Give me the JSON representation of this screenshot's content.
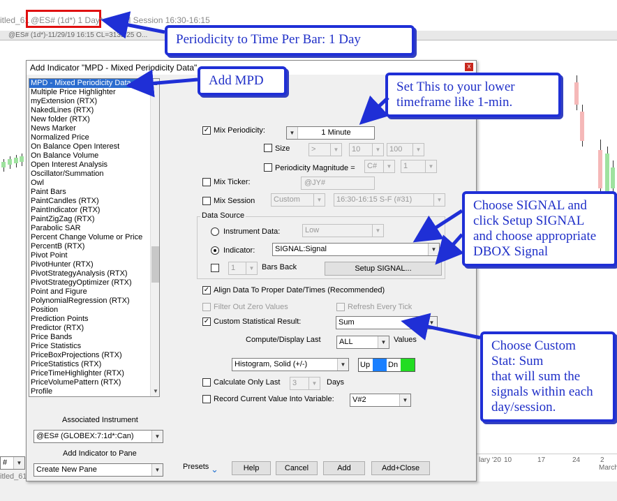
{
  "background": {
    "window_title": "itled_61",
    "symbol": "@ES# (1d*) 1 Day*",
    "session": "Full Session 16:30-16:15",
    "status_line": "@ES# (1d*)-11/29/19 16:15 CL=3135.25 O...",
    "x_ticks": [
      "lary '20",
      "10",
      "17",
      "24",
      "2",
      "March"
    ],
    "bottom_title": "itled_61"
  },
  "dialog": {
    "title": "Add Indicator \"MPD - Mixed Periodicity Data\"",
    "close": "x",
    "indicators": [
      "MPD - Mixed Periodicity Data",
      "Multiple Price Highlighter",
      "myExtension (RTX)",
      "NakedLines (RTX)",
      "New folder (RTX)",
      "News Marker",
      "Normalized Price",
      "On Balance Open Interest",
      "On Balance Volume",
      "Open Interest Analysis",
      "Oscillator/Summation",
      "Owl",
      "Paint Bars",
      "PaintCandles (RTX)",
      "PaintIndicator (RTX)",
      "PaintZigZag (RTX)",
      "Parabolic SAR",
      "Percent Change Volume or Price",
      "PercentB (RTX)",
      "Pivot Point",
      "PivotHunter (RTX)",
      "PivotStrategyAnalysis (RTX)",
      "PivotStrategyOptimizer (RTX)",
      "Point and Figure",
      "PolynomialRegression (RTX)",
      "Position",
      "Prediction Points",
      "Predictor (RTX)",
      "Price Bands",
      "Price Statistics",
      "PriceBoxProjections (RTX)",
      "PriceStatistics (RTX)",
      "PriceTimeHighlighter (RTX)",
      "PriceVolumePattern (RTX)",
      "Profile"
    ],
    "associated_instrument_label": "Associated Instrument",
    "associated_instrument": "@ES# (GLOBEX:7:1d*:Can)",
    "add_to_pane_label": "Add Indicator to Pane",
    "add_to_pane": "Create New Pane",
    "mix_periodicity": {
      "label": "Mix Periodicity:",
      "value": "1 Minute"
    },
    "size": {
      "label": "Size",
      "op": ">",
      "a": "10",
      "b": "100"
    },
    "periodicity_magnitude": {
      "label": "Periodicity Magnitude =",
      "a": "C#",
      "b": "1"
    },
    "mix_ticker": {
      "label": "Mix Ticker:",
      "value": "@JY#"
    },
    "mix_session": {
      "label": "Mix Session",
      "type": "Custom",
      "value": "16:30-16:15 S-F (#31)"
    },
    "data_source": {
      "label": "Data Source",
      "instrument_label": "Instrument Data:",
      "instrument_value": "Low",
      "indicator_label": "Indicator:",
      "indicator_value": "SIGNAL:Signal",
      "bars_back_value": "1",
      "bars_back_label": "Bars Back",
      "setup_button": "Setup SIGNAL..."
    },
    "align_data": "Align Data To Proper Date/Times (Recommended)",
    "filter_zero": "Filter Out Zero Values",
    "refresh_tick": "Refresh Every Tick",
    "custom_stat": {
      "label": "Custom Statistical Result:",
      "value": "Sum"
    },
    "compute_display": {
      "label": "Compute/Display Last",
      "value": "ALL",
      "unit": "Values"
    },
    "style": {
      "value": "Histogram, Solid (+/-)",
      "up": "Up",
      "dn": "Dn",
      "up_color": "#1a7fff",
      "dn_color": "#22dd22"
    },
    "calc_only_last": {
      "label": "Calculate Only Last",
      "value": "3",
      "unit": "Days"
    },
    "record_value": {
      "label": "Record Current Value Into Variable:",
      "value": "V#2"
    },
    "buttons": {
      "presets": "Presets",
      "help": "Help",
      "cancel": "Cancel",
      "add": "Add",
      "add_close": "Add+Close"
    }
  },
  "callouts": {
    "periodicity": "Periodicity to Time Per Bar: 1 Day",
    "add_mpd": "Add MPD",
    "lower_tf": [
      "Set This to your lower",
      "timeframe like 1-min."
    ],
    "signal": [
      "Choose SIGNAL and",
      "click Setup SIGNAL",
      "and choose appropriate",
      "DBOX Signal"
    ],
    "custom_stat": [
      "Choose Custom",
      "Stat: Sum",
      "that will sum the",
      "signals within each",
      "day/session."
    ]
  },
  "colors": {
    "callout_border": "#1f2fd6",
    "callout_text": "#2030c8",
    "highlight": "#e01010",
    "selection": "#2a6ccf"
  }
}
